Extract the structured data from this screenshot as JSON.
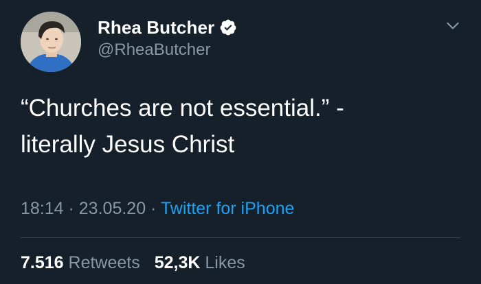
{
  "author": {
    "display_name": "Rhea Butcher",
    "handle": "@RheaButcher",
    "verified": true
  },
  "tweet": {
    "line1": "“Churches are not essential.” -",
    "line2": "literally Jesus Christ"
  },
  "meta": {
    "time": "18:14",
    "separator": " · ",
    "date": "23.05.20",
    "separator2": " · ",
    "source": "Twitter for iPhone"
  },
  "stats": {
    "retweets_count": "7.516",
    "retweets_label": "Retweets",
    "likes_count": "52,3K",
    "likes_label": "Likes"
  },
  "colors": {
    "background": "#15202b",
    "secondary_text": "#8899a6",
    "accent": "#1da1f2",
    "divider": "#38444d"
  },
  "icons": {
    "verified": "verified-badge-icon",
    "menu": "chevron-down-icon"
  }
}
